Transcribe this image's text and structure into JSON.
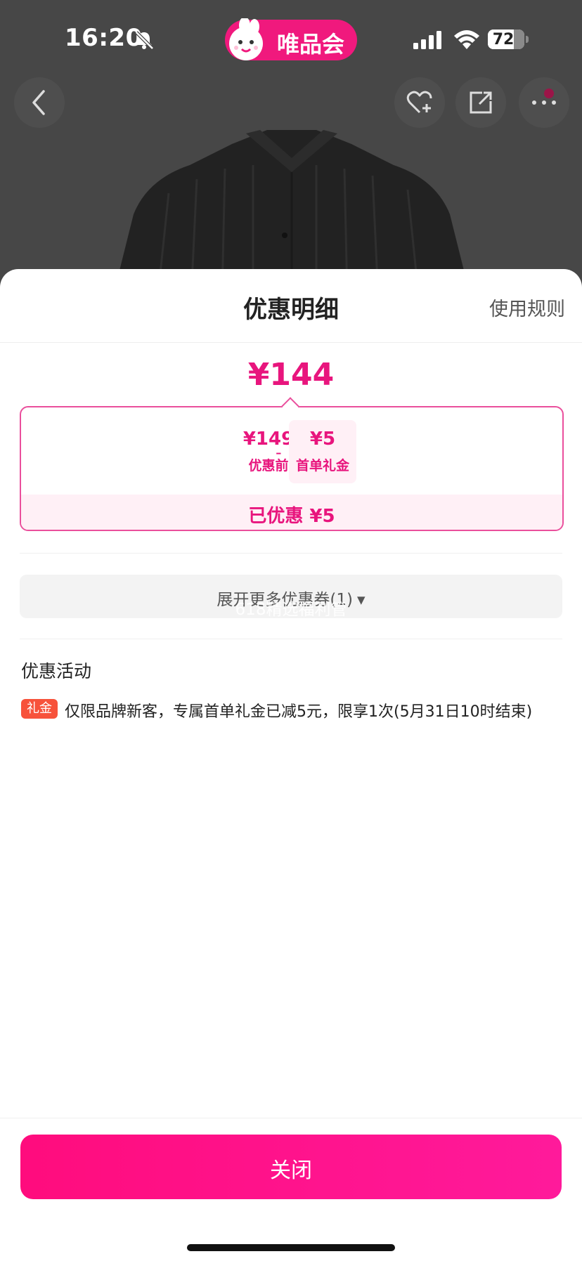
{
  "status_bar": {
    "time": "16:20",
    "battery_level": "72",
    "battery_fraction": 0.72
  },
  "app": {
    "brand_name": "唯品会"
  },
  "icons": {
    "back": "chevron-left-icon",
    "favorite": "heart-plus-icon",
    "share": "share-icon",
    "more": "more-dots-icon",
    "silent": "bell-slash-icon",
    "signal": "cellular-signal-icon",
    "wifi": "wifi-icon",
    "battery": "battery-icon",
    "expand": "caret-down-icon"
  },
  "sheet": {
    "title": "优惠明细",
    "rules_link": "使用规则",
    "final_price": "¥144",
    "breakdown": {
      "original_price": "¥149",
      "original_label": "优惠前",
      "operator": "-",
      "discount_amount": "¥5",
      "discount_label": "首单礼金",
      "saved_text": "已优惠 ¥5"
    },
    "expand_button": "展开更多优惠券(1)",
    "watermark_text": "618精选福利管",
    "promo_section": {
      "heading": "优惠活动",
      "items": [
        {
          "tag": "礼金",
          "text": "仅限品牌新客，专属首单礼金已减5元，限享1次(5月31日10时结束)"
        }
      ]
    },
    "close_button": "关闭"
  },
  "colors": {
    "accent": "#e8157d",
    "button_gradient_start": "#ff0c7d",
    "button_gradient_end": "#ff1a9b",
    "tag": "#f7523b",
    "light_pink": "#fff0f6"
  }
}
